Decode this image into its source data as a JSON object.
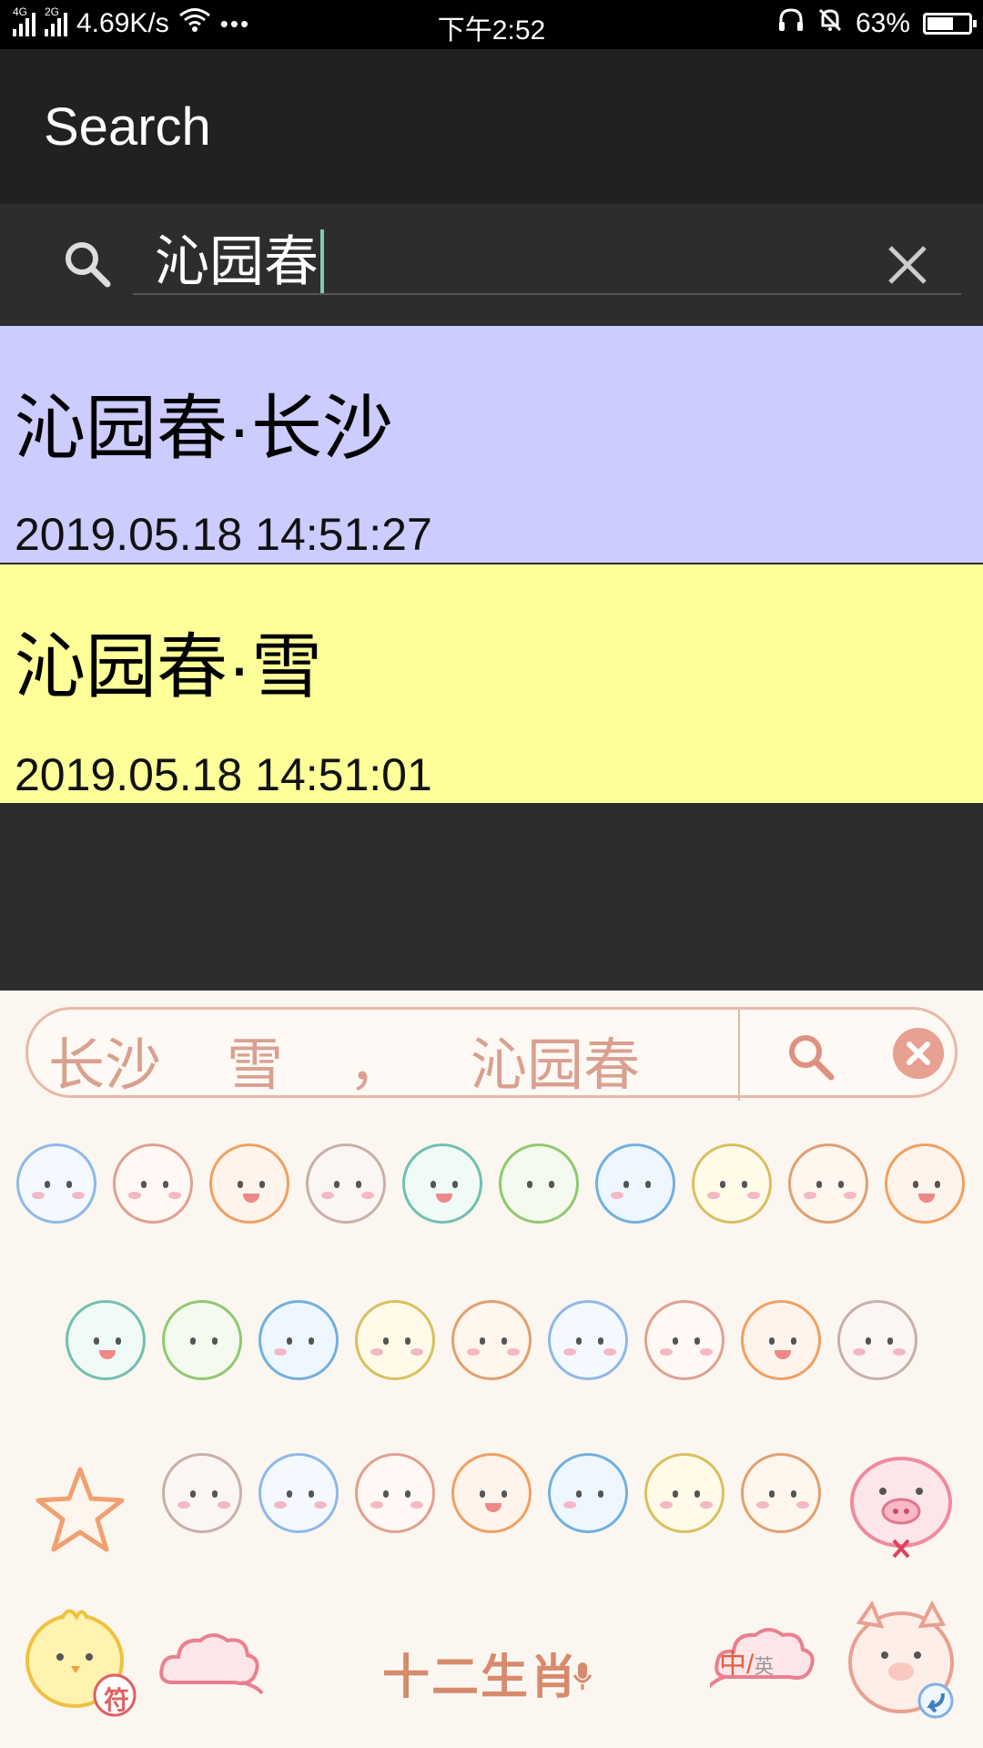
{
  "status_bar": {
    "network_1": "4G",
    "network_2": "2G",
    "speed": "4.69K/s",
    "time": "下午2:52",
    "battery": "63%",
    "battery_level": 0.63
  },
  "app_bar": {
    "title": "Search"
  },
  "search": {
    "query": "沁园春"
  },
  "results": [
    {
      "title": "沁园春·长沙",
      "date": "2019.05.18 14:51:27",
      "color": "#ccccff"
    },
    {
      "title": "沁园春·雪",
      "date": "2019.05.18 14:51:01",
      "color": "#ffff99"
    }
  ],
  "keyboard": {
    "candidates": [
      "长沙",
      "雪",
      "，",
      "沁园春"
    ],
    "center_label": "十二生肖",
    "lang_primary": "中",
    "lang_secondary": "英",
    "symbol_label": "符"
  }
}
